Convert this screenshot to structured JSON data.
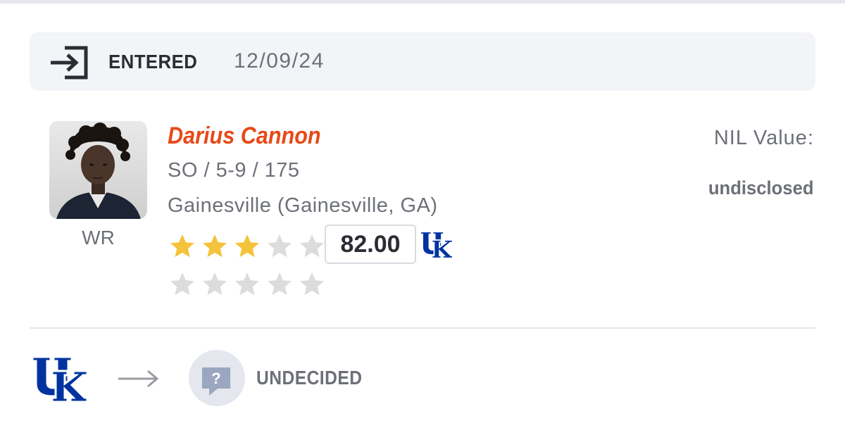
{
  "status": {
    "label": "ENTERED",
    "date": "12/09/24",
    "icon": "enter-portal-icon"
  },
  "player": {
    "name": "Darius Cannon",
    "vitals": "SO / 5-9 / 175",
    "hometown": "Gainesville (Gainesville, GA)",
    "position": "WR",
    "photo_alt": "Darius Cannon headshot",
    "star_rating": 3,
    "star_max": 5,
    "rating": "82.00",
    "rating_school_logo": "uk-logo",
    "secondary_star_rating": 0
  },
  "nil": {
    "label": "NIL Value:",
    "value": "undisclosed"
  },
  "transfer": {
    "from_school_logo": "uk-logo",
    "arrow_icon": "right-arrow-icon",
    "to_school_icon": "question-mark-icon",
    "to_school_label": "UNDECIDED"
  },
  "colors": {
    "name": "#e64a19",
    "star_filled": "#f5c33b",
    "star_empty": "#dcdcdc",
    "school_blue": "#0033a0",
    "muted_text": "#6d7078",
    "panel_bg": "#f3f4f8"
  }
}
